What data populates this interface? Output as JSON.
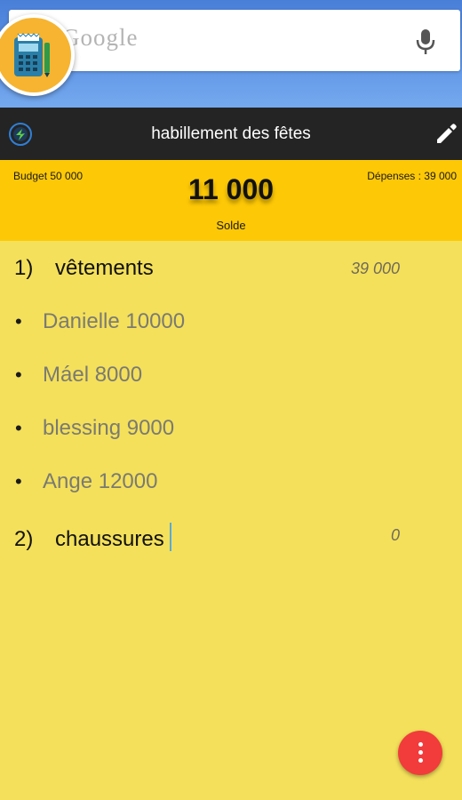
{
  "search": {
    "hint": "Google"
  },
  "titlebar": {
    "title": "habillement des fêtes"
  },
  "summary": {
    "budget": "Budget 50 000",
    "depenses": "Dépenses : 39 000",
    "solde_value": "11 000",
    "solde_label": "Solde"
  },
  "categories": [
    {
      "number": "1)",
      "name": "vêtements",
      "amount": "39 000",
      "items": [
        "Danielle  10000",
        "Máel  8000",
        "blessing  9000",
        "Ange  12000"
      ]
    },
    {
      "number": "2)",
      "name": "chaussures",
      "amount": "0",
      "items": []
    }
  ],
  "colors": {
    "band": "#fdc806",
    "list_bg": "#f4e05a",
    "titlebar": "#242424",
    "fab": "#f23b3b",
    "app_badge": "#f6b430"
  },
  "icons": [
    "calculator-app-icon",
    "mic-icon",
    "app-logo-icon",
    "edit-pencil-icon",
    "more-vert-icon"
  ]
}
